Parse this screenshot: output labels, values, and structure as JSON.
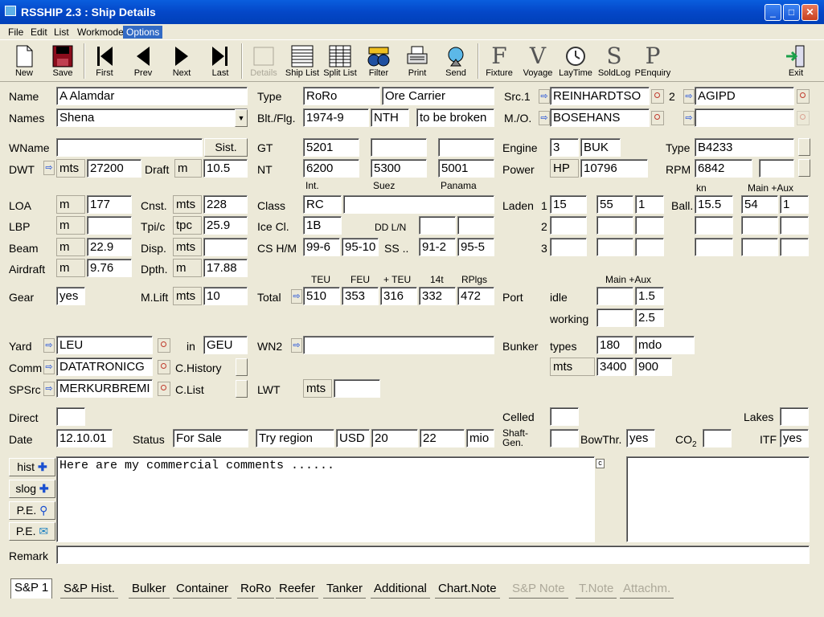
{
  "window": {
    "title": "RSSHIP 2.3 : Ship Details",
    "min": "_",
    "max": "□",
    "close": "✕"
  },
  "menu": [
    "File",
    "Edit",
    "List",
    "Workmode",
    "Options"
  ],
  "toolbar": {
    "new": "New",
    "save": "Save",
    "first": "First",
    "prev": "Prev",
    "next": "Next",
    "last": "Last",
    "details": "Details",
    "ship_list": "Ship List",
    "split_list": "Split List",
    "filter": "Filter",
    "print": "Print",
    "send": "Send",
    "fixture": "Fixture",
    "voyage": "Voyage",
    "laytime": "LayTime",
    "soldlog": "SoldLog",
    "penquiry": "PEnquiry",
    "exit": "Exit",
    "fixture_glyph": "F",
    "voyage_glyph": "V",
    "soldlog_glyph": "S",
    "penquiry_glyph": "P"
  },
  "labels": {
    "name": "Name",
    "names": "Names",
    "type": "Type",
    "blt_flg": "Blt./Flg.",
    "src1": "Src.1",
    "mo": "M./O.",
    "wname": "WName",
    "sist": "Sist.",
    "dwt": "DWT",
    "draft": "Draft",
    "gt": "GT",
    "nt": "NT",
    "int": "Int.",
    "suez": "Suez",
    "panama": "Panama",
    "engine": "Engine",
    "type2": "Type",
    "power": "Power",
    "rpm": "RPM",
    "kn": "kn",
    "main_aux": "Main +Aux",
    "loa": "LOA",
    "lbp": "LBP",
    "beam": "Beam",
    "airdraft": "Airdraft",
    "cnst": "Cnst.",
    "tpic": "Tpi/c",
    "disp": "Disp.",
    "dpth": "Dpth.",
    "class": "Class",
    "icecl": "Ice Cl.",
    "ddln": "DD L/N",
    "cshm": "CS H/M",
    "ss": "SS ..",
    "laden": "Laden",
    "row1": "1",
    "row2": "2",
    "row3": "3",
    "ball": "Ball.",
    "gear": "Gear",
    "mlift": "M.Lift",
    "total": "Total",
    "teu": "TEU",
    "feu": "FEU",
    "plus_teu": "+ TEU",
    "t14": "14t",
    "rplgs": "RPlgs",
    "port": "Port",
    "idle": "idle",
    "working": "working",
    "main_aux2": "Main +Aux",
    "yard": "Yard",
    "in": "in",
    "wn2": "WN2",
    "bunker": "Bunker",
    "types": "types",
    "comm": "Comm",
    "chistory": "C.History",
    "spsrc": "SPSrc",
    "clist": "C.List",
    "lwt": "LWT",
    "direct": "Direct",
    "celled": "Celled",
    "lakes": "Lakes",
    "date": "Date",
    "status": "Status",
    "shaft_gen": "Shaft-\nGen.",
    "bowthr": "BowThr.",
    "co2": "CO",
    "co2_sub": "2",
    "itf": "ITF",
    "hist": "hist",
    "slog": "slog",
    "pe1": "P.E.",
    "pe2": "P.E.",
    "remark": "Remark",
    "src_num": "2"
  },
  "values": {
    "name": "A Alamdar",
    "names": "Shena",
    "type": "RoRo",
    "type_desc": "Ore Carrier",
    "blt": "1974-9",
    "flg": "NTH",
    "flag_status": "to be broken",
    "src1": "REINHARDTSO",
    "src2": "AGIPD",
    "mo": "BOSEHANS",
    "mo2": "",
    "wname": "",
    "dwt_unit": "mts",
    "dwt": "27200",
    "draft_unit": "m",
    "draft": "10.5",
    "gt": "5201",
    "gt2": "",
    "gt3": "",
    "nt": "6200",
    "nt_suez": "5300",
    "nt_panama": "5001",
    "engine_no": "3",
    "engine": "BUK",
    "engine_type": "B4233",
    "power_unit": "HP",
    "power": "10796",
    "rpm": "6842",
    "rpm2": "",
    "loa_unit": "m",
    "loa": "177",
    "lbp_unit": "m",
    "lbp": "",
    "beam_unit": "m",
    "beam": "22.9",
    "air_unit": "m",
    "air": "9.76",
    "cnst_unit": "mts",
    "cnst": "228",
    "tpic_unit": "tpc",
    "tpic": "25.9",
    "disp_unit": "mts",
    "disp": "",
    "dpth_unit": "m",
    "dpth": "17.88",
    "class": "RC",
    "class2": "",
    "icecl": "1B",
    "ddln1": "",
    "ddln2": "",
    "csh": "99-6",
    "csm": "95-10",
    "ss1": "91-2",
    "ss2": "95-5",
    "laden1_a": "15",
    "laden1_b": "55",
    "laden1_c": "1",
    "ball_kn": "15.5",
    "ball_main": "54",
    "ball_aux": "1",
    "gear": "yes",
    "mlift_unit": "mts",
    "mlift": "10",
    "teu": "510",
    "feu": "353",
    "plus_teu": "316",
    "t14": "332",
    "rplgs": "472",
    "idle_main": "",
    "idle_aux": "1.5",
    "work_main": "",
    "work_aux": "2.5",
    "yard": "LEU",
    "yard_in": "GEU",
    "wn2": "",
    "bunker_types": "180",
    "bunker_types2": "mdo",
    "bunker_unit": "mts",
    "bunker_mts": "3400",
    "bunker_mts2": "900",
    "comm": "DATATRONICG",
    "spsrc": "MERKURBREMI",
    "lwt_unit": "mts",
    "lwt": "",
    "direct": "",
    "celled": "",
    "lakes": "",
    "date": "12.10.01",
    "status": "For Sale",
    "region": "Try region",
    "currency": "USD",
    "price_low": "20",
    "price_high": "22",
    "price_unit": "mio",
    "shaftgen": "",
    "bowthr": "yes",
    "co2": "",
    "itf": "yes",
    "comments": "Here are my commercial comments ......",
    "comments_corner": "c",
    "remark": ""
  },
  "tabs": [
    {
      "label": "S&P 1",
      "state": "active"
    },
    {
      "label": "S&P Hist."
    },
    {
      "label": "Bulker"
    },
    {
      "label": "Container"
    },
    {
      "label": "RoRo"
    },
    {
      "label": "Reefer"
    },
    {
      "label": "Tanker"
    },
    {
      "label": "Additional"
    },
    {
      "label": "Chart.Note"
    },
    {
      "label": "S&P Note",
      "state": "disabled"
    },
    {
      "label": "T.Note",
      "state": "disabled"
    },
    {
      "label": "Attachm.",
      "state": "disabled"
    }
  ],
  "colors": {
    "title_blue": "#0447c8",
    "menu_highlight": "#316ac5",
    "panel": "#ece9d8",
    "arrow_blue": "#0b3fd8"
  }
}
